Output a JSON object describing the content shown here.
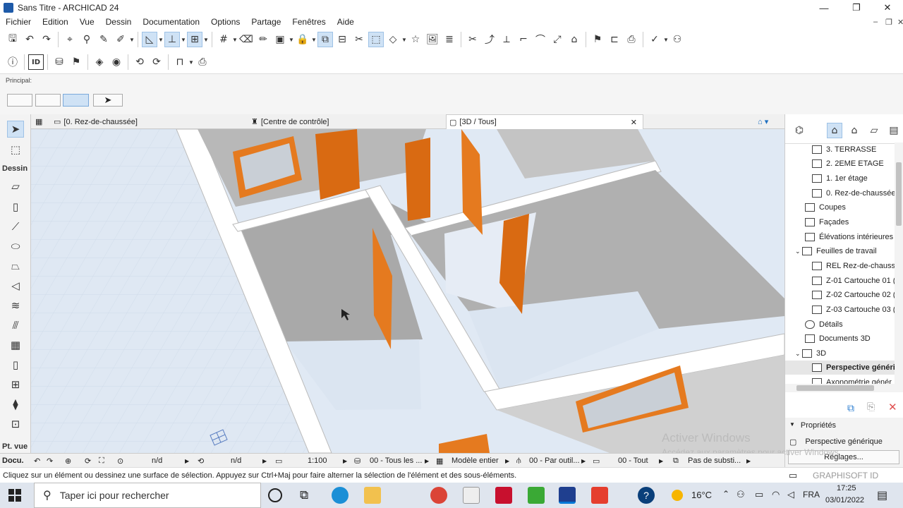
{
  "window": {
    "title": "Sans Titre - ARCHICAD 24"
  },
  "menu": [
    "Fichier",
    "Edition",
    "Vue",
    "Dessin",
    "Documentation",
    "Options",
    "Partage",
    "Fenêtres",
    "Aide"
  ],
  "infobox": {
    "label": "Principal:"
  },
  "toolbox": {
    "section_dessin": "Dessin",
    "section_ptvue": "Pt. vue",
    "section_docu": "Docu."
  },
  "tabs": {
    "floor": "[0. Rez-de-chaussée]",
    "control": "[Centre de contrôle]",
    "view3d": "[3D / Tous]"
  },
  "navigator": {
    "items": [
      {
        "label": "3. TERRASSE",
        "indent": 2
      },
      {
        "label": "2. 2EME ETAGE",
        "indent": 2
      },
      {
        "label": "1. 1er étage",
        "indent": 2
      },
      {
        "label": "0. Rez-de-chaussée",
        "indent": 2
      },
      {
        "label": "Coupes",
        "indent": 1
      },
      {
        "label": "Façades",
        "indent": 1
      },
      {
        "label": "Élévations intérieures",
        "indent": 1
      },
      {
        "label": "Feuilles de travail",
        "indent": 1
      },
      {
        "label": "REL Rez-de-chaussé",
        "indent": 2
      },
      {
        "label": "Z-01 Cartouche 01 (",
        "indent": 2
      },
      {
        "label": "Z-02 Cartouche 02 (",
        "indent": 2
      },
      {
        "label": "Z-03 Cartouche 03 (",
        "indent": 2
      },
      {
        "label": "Détails",
        "indent": 1
      },
      {
        "label": "Documents 3D",
        "indent": 1
      },
      {
        "label": "3D",
        "indent": 1
      },
      {
        "label": "Perspective génériq",
        "indent": 2
      },
      {
        "label": "Axonométrie génér",
        "indent": 2
      }
    ]
  },
  "properties": {
    "header": "Propriétés",
    "value": "Perspective générique",
    "settings": "Réglages..."
  },
  "statusbar": {
    "nd1": "n/d",
    "nd2": "n/d",
    "scale": "1:100",
    "layers": "00 - Tous les ...",
    "model": "Modèle entier",
    "pen": "00 - Par outil...",
    "all": "00 - Tout",
    "subst": "Pas de substi..."
  },
  "hint": "Cliquez sur un élément ou dessinez une surface de sélection. Appuyez sur Ctrl+Maj pour faire alterner la sélection de l'élément et des sous-éléments.",
  "watermark": {
    "line1": "Activer Windows",
    "line2": "Accédez aux paramètres pour activer Windows."
  },
  "brand": "GRAPHISOFT ID",
  "taskbar": {
    "search": "Taper ici pour rechercher",
    "temp": "16°C",
    "lang": "FRA",
    "time": "17:25",
    "date": "03/01/2022"
  },
  "colors": {
    "accent": "#0078d7",
    "door": "#e87722",
    "wall": "#d4d4d4",
    "floor": "#dde6f2"
  }
}
